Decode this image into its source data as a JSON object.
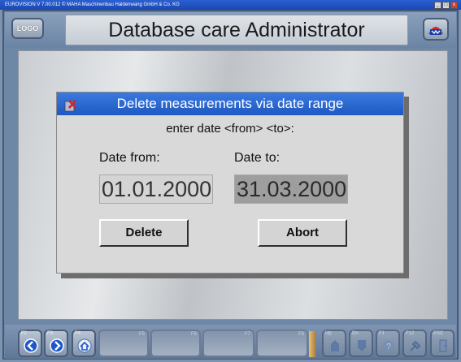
{
  "window": {
    "title": "EUROVISION V 7.00.012  © MAHA Maschinenbau Haldenwang GmbH & Co. KG",
    "controls": [
      "_",
      "□",
      "x"
    ]
  },
  "header": {
    "logo_label": "LOGO",
    "title": "Database care Administrator",
    "brand_icon": "maha-logo-icon"
  },
  "dialog": {
    "title": "Delete measurements via date range",
    "icon": "delete-icon",
    "prompt": "enter date <from> <to>:",
    "date_from_label": "Date from:",
    "date_to_label": "Date to:",
    "date_from_value": "01.01.2000",
    "date_to_value": "31.03.2000",
    "delete_label": "Delete",
    "abort_label": "Abort"
  },
  "bottom_bar": {
    "keys": [
      {
        "key": "F2",
        "icon": "arrow-left-icon"
      },
      {
        "key": "F3",
        "icon": "arrow-right-icon"
      },
      {
        "key": "F4",
        "icon": "home-icon"
      }
    ],
    "slots": [
      "F5",
      "F6",
      "F7",
      "F8",
      "F9"
    ],
    "right_keys": [
      {
        "key": "Up",
        "icon": "up-icon"
      },
      {
        "key": "Dn",
        "icon": "down-icon"
      },
      {
        "key": "F1",
        "icon": "help-icon"
      },
      {
        "key": "F12",
        "icon": "tool-icon"
      },
      {
        "key": "ESC",
        "icon": "exit-icon"
      }
    ]
  },
  "colors": {
    "dialog_title_bg": "#2a6ad4",
    "frame_bg": "#6f87a6"
  }
}
